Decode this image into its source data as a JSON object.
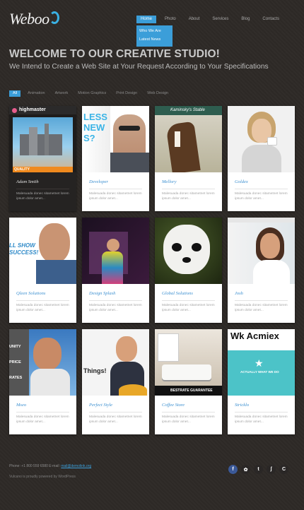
{
  "site": {
    "logo_text": "Weboo"
  },
  "nav": {
    "items": [
      "Home",
      "Photo",
      "About",
      "Services",
      "Blog",
      "Contacts"
    ],
    "submenu": [
      "Who We Are",
      "Latest News"
    ]
  },
  "hero": {
    "title": "WELCOME TO OUR CREATIVE STUDIO!",
    "subtitle": "We Intend to Create a Web Site at Your Request According to Your Specifications"
  },
  "filters": [
    "All",
    "Animation",
    "Artwork",
    "Motion Graphics",
    "Print Design",
    "Web Design"
  ],
  "portfolio": [
    {
      "title": "Adam Smith",
      "desc": "Malesuada donec sitametnet lorem ipsum dolor amet...",
      "thumb_text": "highmaster",
      "thumb_badge": "QUALITY"
    },
    {
      "title": "Developer",
      "desc": "Malesuada donec sitametnet lorem ipsum dolor amet...",
      "thumb_text": "LESS NEW S?"
    },
    {
      "title": "Mellory",
      "desc": "Malesuada donec sitametnet lorem ipsum dolor amet...",
      "thumb_text": "Kaminsky's Stable"
    },
    {
      "title": "Goldex",
      "desc": "Malesuada donec sitametnet lorem ipsum dolor amet..."
    },
    {
      "title": "Qleen Solutions",
      "desc": "Malesuada donec sitametnet lorem ipsum dolor amet...",
      "thumb_text": "LL SHOW SUCCESS!"
    },
    {
      "title": "Design Splash",
      "desc": "Malesuada donec sitametnet lorem ipsum dolor amet..."
    },
    {
      "title": "Global Solutions",
      "desc": "Malesuada donec sitametnet lorem ipsum dolor amet..."
    },
    {
      "title": "Josh",
      "desc": "Malesuada donec sitametnet lorem ipsum dolor amet..."
    },
    {
      "title": "Mseo",
      "desc": "Malesuada donec sitametnet lorem ipsum dolor amet...",
      "thumb_text": "UNITY PRICE RATES"
    },
    {
      "title": "Perfect Style",
      "desc": "Malesuada donec sitametnet lorem ipsum dolor amet...",
      "thumb_text": "Things!"
    },
    {
      "title": "Coffee Store",
      "desc": "Malesuada donec sitametnet lorem ipsum dolor amet...",
      "thumb_text": "BESTRATE GUARANTEE"
    },
    {
      "title": "Stricklo",
      "desc": "Malesuada donec sitametnet lorem ipsum dolor amet...",
      "thumb_text": "Wk Acmiex",
      "thumb_badge": "ACTUALLY WHAT WE DO"
    }
  ],
  "footer": {
    "phone_label": "Phone: +1 800 559 6580 E-mail:",
    "email": "mail@demolink.org",
    "powered": "Vulcano is proudly powered by WordPress"
  },
  "social": [
    "f",
    "✿",
    "t",
    "ʃ",
    "C"
  ],
  "colors": {
    "accent": "#3b9ed9",
    "background": "#2e2a27"
  }
}
